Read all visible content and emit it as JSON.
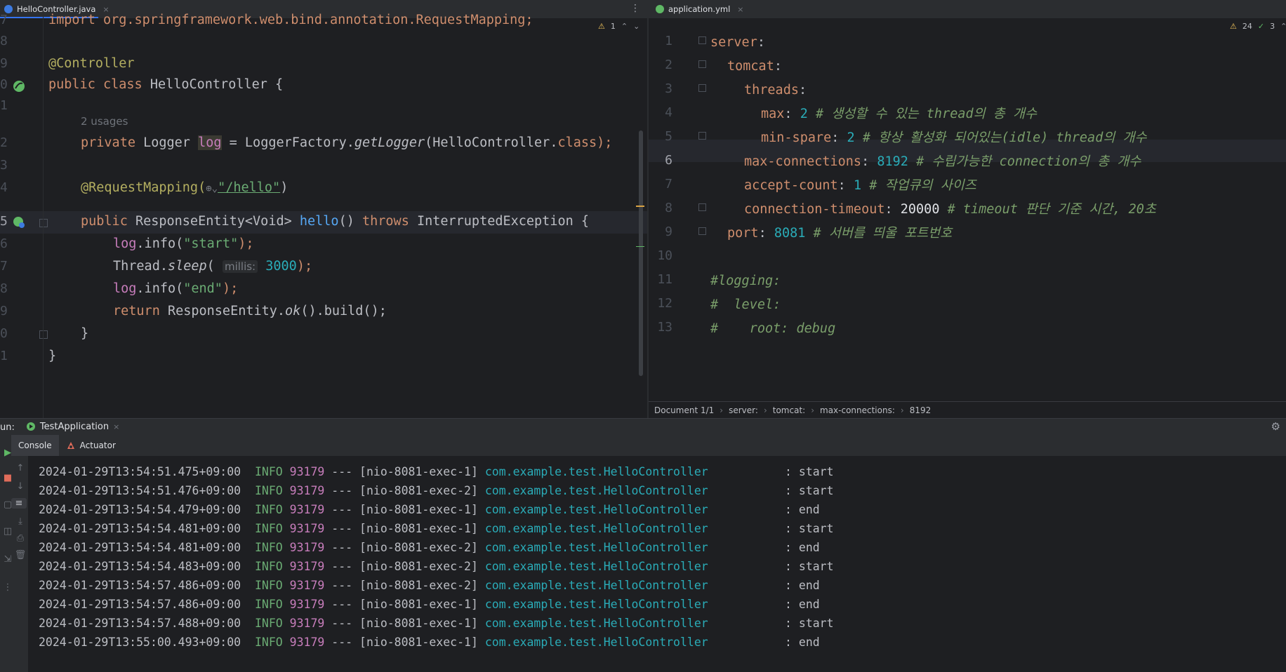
{
  "left_editor": {
    "tab": {
      "label": "HelloController.java",
      "close": "×"
    },
    "inspection": {
      "warnings": "1"
    },
    "line_numbers": [
      "7",
      "8",
      "9",
      "0",
      "1",
      "",
      "2",
      "3",
      "4",
      "5",
      "6",
      "7",
      "8",
      "9",
      "0",
      "1"
    ],
    "code": {
      "import_line": "import org.springframework.web.bind.annotation.RequestMapping;",
      "annotation_controller": "@Controller",
      "kw_public": "public",
      "kw_class": "class",
      "class_name": "HelloController {",
      "usages": "2 usages",
      "kw_private": "private",
      "logger_type": "Logger",
      "field_log": "log",
      "logger_init_a": " = LoggerFactory.",
      "logger_init_fn": "getLogger",
      "logger_init_b": "(HelloController.",
      "kw_class2": "class",
      "logger_init_c": ");",
      "annotation_rm": "@RequestMapping(",
      "rm_path": "\"/hello\"",
      "rm_close": ")",
      "method_kw": "public",
      "method_ret": "ResponseEntity<Void>",
      "method_name": "hello",
      "method_parens": "()",
      "kw_throws": "throws",
      "method_exc": "InterruptedException {",
      "log_start_call": ".info(",
      "log_start_arg": "\"start\"",
      "stmt_end": ");",
      "thread_sleep_a": "Thread.",
      "thread_sleep_fn": "sleep",
      "thread_sleep_paren": "(",
      "hint_millis": "millis:",
      "sleep_value": "3000",
      "log_end_arg": "\"end\"",
      "kw_return": "return",
      "return_a": "ResponseEntity.",
      "return_fn": "ok",
      "return_b": "().build();",
      "close_method": "}",
      "close_class": "}"
    }
  },
  "right_editor": {
    "tab": {
      "label": "application.yml",
      "close": "×"
    },
    "inspection": {
      "warnings": "24",
      "checks": "3"
    },
    "line_numbers": [
      "1",
      "2",
      "3",
      "4",
      "5",
      "6",
      "7",
      "8",
      "9",
      "10",
      "11",
      "12",
      "13"
    ],
    "yaml": {
      "server": "server",
      "tomcat": "tomcat",
      "threads": "threads",
      "max": "max",
      "max_value": "2",
      "max_comment": "# 생성할 수 있는 thread의 총 개수",
      "min_spare": "min-spare",
      "min_spare_value": "2",
      "min_spare_comment": "# 항상 활성화 되어있는(idle) thread의 개수",
      "max_connections": "max-connections",
      "max_connections_value": "8192",
      "max_connections_comment": "# 수립가능한 connection의 총 개수",
      "accept_count": "accept-count",
      "accept_count_value": "1",
      "accept_count_comment": "# 작업큐의 사이즈",
      "connection_timeout": "connection-timeout",
      "connection_timeout_value": "20000",
      "connection_timeout_comment": "# timeout 판단 기준 시간, 20초",
      "port": "port",
      "port_value": "8081",
      "port_comment": "# 서버를 띄울 포트번호",
      "logging_comment": "#logging:",
      "level_comment": "#  level:",
      "root_comment": "#    root: debug"
    },
    "breadcrumb": [
      "Document 1/1",
      "server:",
      "tomcat:",
      "max-connections:",
      "8192"
    ]
  },
  "run_window": {
    "label": "un:",
    "config_tab": "TestApplication",
    "close": "×",
    "tabs": [
      "Console",
      "Actuator"
    ],
    "logs": [
      {
        "ts": "2024-01-29T13:54:51.475+09:00",
        "level": "INFO",
        "pid": "93179",
        "sep": "---",
        "thread": "[nio-8081-exec-1]",
        "logger": "com.example.test.HelloController",
        "msg": ": start"
      },
      {
        "ts": "2024-01-29T13:54:51.476+09:00",
        "level": "INFO",
        "pid": "93179",
        "sep": "---",
        "thread": "[nio-8081-exec-2]",
        "logger": "com.example.test.HelloController",
        "msg": ": start"
      },
      {
        "ts": "2024-01-29T13:54:54.479+09:00",
        "level": "INFO",
        "pid": "93179",
        "sep": "---",
        "thread": "[nio-8081-exec-1]",
        "logger": "com.example.test.HelloController",
        "msg": ": end"
      },
      {
        "ts": "2024-01-29T13:54:54.481+09:00",
        "level": "INFO",
        "pid": "93179",
        "sep": "---",
        "thread": "[nio-8081-exec-1]",
        "logger": "com.example.test.HelloController",
        "msg": ": start"
      },
      {
        "ts": "2024-01-29T13:54:54.481+09:00",
        "level": "INFO",
        "pid": "93179",
        "sep": "---",
        "thread": "[nio-8081-exec-2]",
        "logger": "com.example.test.HelloController",
        "msg": ": end"
      },
      {
        "ts": "2024-01-29T13:54:54.483+09:00",
        "level": "INFO",
        "pid": "93179",
        "sep": "---",
        "thread": "[nio-8081-exec-2]",
        "logger": "com.example.test.HelloController",
        "msg": ": start"
      },
      {
        "ts": "2024-01-29T13:54:57.486+09:00",
        "level": "INFO",
        "pid": "93179",
        "sep": "---",
        "thread": "[nio-8081-exec-2]",
        "logger": "com.example.test.HelloController",
        "msg": ": end"
      },
      {
        "ts": "2024-01-29T13:54:57.486+09:00",
        "level": "INFO",
        "pid": "93179",
        "sep": "---",
        "thread": "[nio-8081-exec-1]",
        "logger": "com.example.test.HelloController",
        "msg": ": end"
      },
      {
        "ts": "2024-01-29T13:54:57.488+09:00",
        "level": "INFO",
        "pid": "93179",
        "sep": "---",
        "thread": "[nio-8081-exec-1]",
        "logger": "com.example.test.HelloController",
        "msg": ": start"
      },
      {
        "ts": "2024-01-29T13:55:00.493+09:00",
        "level": "INFO",
        "pid": "93179",
        "sep": "---",
        "thread": "[nio-8081-exec-1]",
        "logger": "com.example.test.HelloController",
        "msg": ": end"
      }
    ]
  },
  "icons": {
    "java_file": "java-file-icon",
    "yaml_file": "yaml-file-icon",
    "spring_bean": "spring-bean-gutter-icon",
    "run_config": "spring-boot-run-icon",
    "actuator": "actuator-icon",
    "settings": "gear-icon"
  },
  "colors": {
    "accent": "#3574f0",
    "keyword": "#cf8e6d",
    "string": "#6aab73",
    "number": "#2aacb8",
    "annotation": "#b3ae60",
    "field": "#c77dbb",
    "warning": "#f2c55c"
  }
}
